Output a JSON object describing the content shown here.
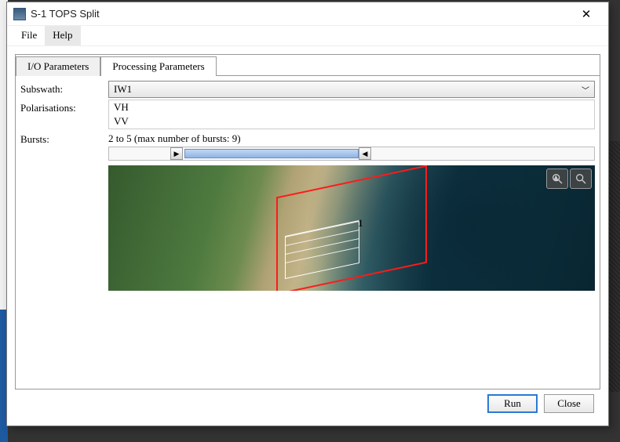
{
  "window": {
    "title": "S-1 TOPS Split"
  },
  "menu": {
    "file": "File",
    "help": "Help"
  },
  "tabs": {
    "io": "I/O Parameters",
    "processing": "Processing Parameters"
  },
  "labels": {
    "subswath": "Subswath:",
    "polarisations": "Polarisations:",
    "bursts": "Bursts:"
  },
  "subswath": {
    "value": "IW1"
  },
  "polarisations": {
    "items": [
      "VH",
      "VV"
    ]
  },
  "bursts": {
    "text": "2 to 5 (max number of bursts: 9)"
  },
  "map": {
    "swath_label": "1"
  },
  "buttons": {
    "run": "Run",
    "close": "Close"
  }
}
